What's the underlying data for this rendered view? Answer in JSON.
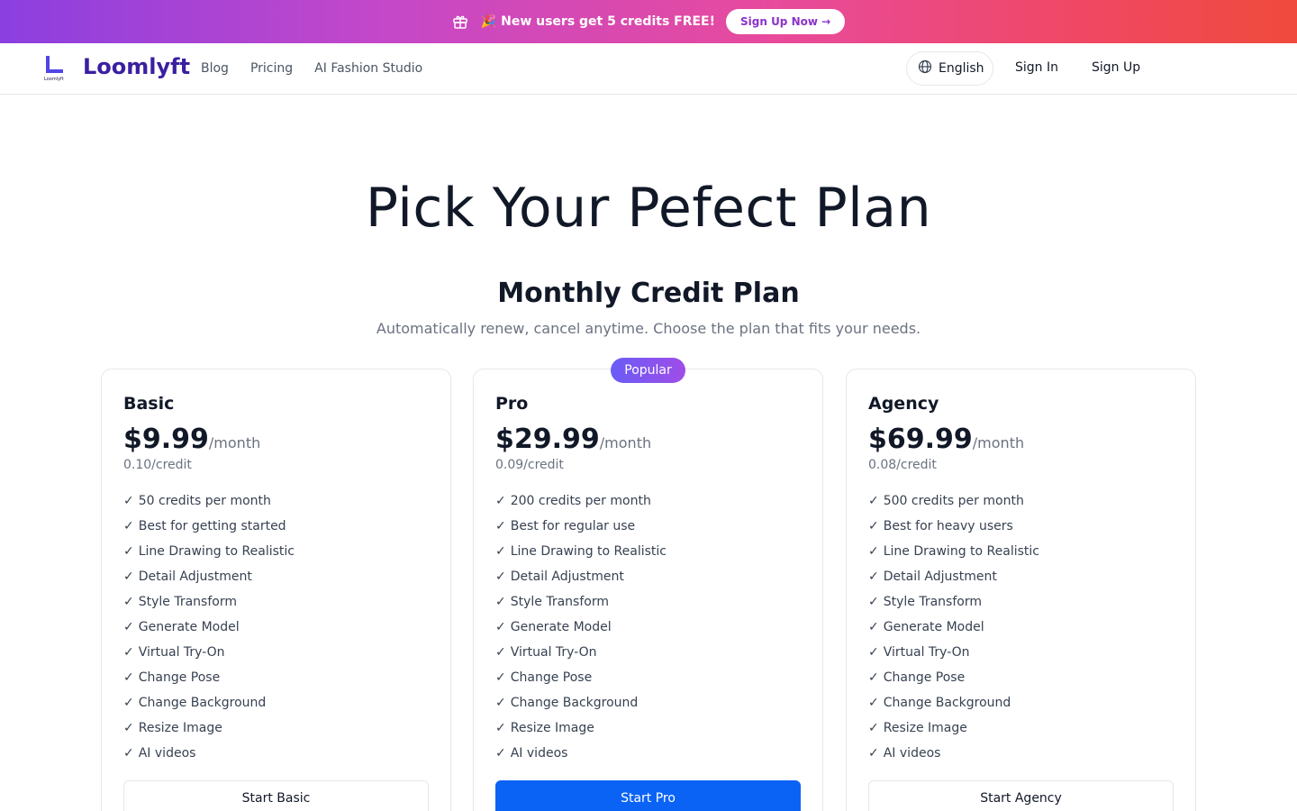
{
  "banner": {
    "message": "🎉 New users get 5 credits FREE!",
    "cta_label": "Sign Up Now →"
  },
  "nav": {
    "logo_small_text": "Loomlyft",
    "brand": "Loomlyft",
    "links": [
      {
        "label": "Blog"
      },
      {
        "label": "Pricing"
      },
      {
        "label": "AI Fashion Studio"
      }
    ],
    "language": "English",
    "sign_in": "Sign In",
    "sign_up": "Sign Up"
  },
  "hero": {
    "title": "Pick Your Pefect Plan",
    "plan_title": "Monthly Credit Plan",
    "plan_subtitle": "Automatically renew, cancel anytime. Choose the plan that fits your needs."
  },
  "popular_badge": "Popular",
  "colors": {
    "brand": "#3b1fa0",
    "primary_button": "#0b63f6",
    "banner_start": "#8b3fe0",
    "banner_end": "#f04a3c"
  },
  "plans": [
    {
      "name": "Basic",
      "price": "$9.99",
      "period": "/month",
      "per_credit": "0.10/credit",
      "features": [
        "50 credits per month",
        "Best for getting started",
        "Line Drawing to Realistic",
        "Detail Adjustment",
        "Style Transform",
        "Generate Model",
        "Virtual Try-On",
        "Change Pose",
        "Change Background",
        "Resize Image",
        "AI videos"
      ],
      "button": "Start Basic"
    },
    {
      "name": "Pro",
      "price": "$29.99",
      "period": "/month",
      "per_credit": "0.09/credit",
      "features": [
        "200 credits per month",
        "Best for regular use",
        "Line Drawing to Realistic",
        "Detail Adjustment",
        "Style Transform",
        "Generate Model",
        "Virtual Try-On",
        "Change Pose",
        "Change Background",
        "Resize Image",
        "AI videos"
      ],
      "button": "Start Pro"
    },
    {
      "name": "Agency",
      "price": "$69.99",
      "period": "/month",
      "per_credit": "0.08/credit",
      "features": [
        "500 credits per month",
        "Best for heavy users",
        "Line Drawing to Realistic",
        "Detail Adjustment",
        "Style Transform",
        "Generate Model",
        "Virtual Try-On",
        "Change Pose",
        "Change Background",
        "Resize Image",
        "AI videos"
      ],
      "button": "Start Agency"
    }
  ]
}
